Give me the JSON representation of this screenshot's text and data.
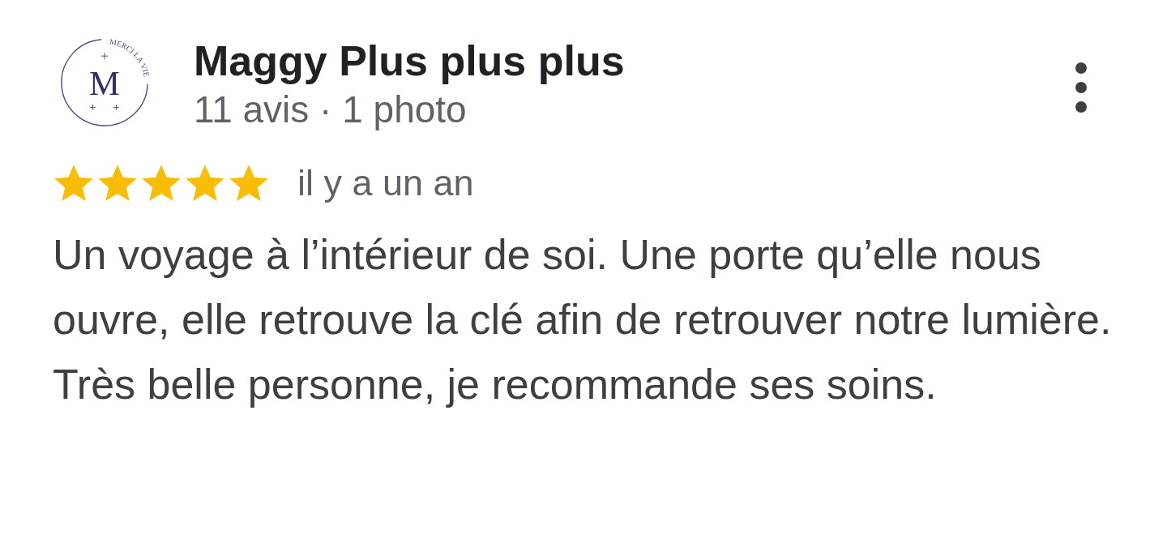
{
  "review": {
    "avatar": {
      "letter": "M",
      "arc_text": "MERCI LA VIE"
    },
    "author": "Maggy Plus plus plus",
    "meta": "11 avis · 1 photo",
    "stars": 5,
    "time": "il y a un an",
    "paragraphs": [
      "Un voyage à l’intérieur de soi. Une porte qu’elle nous ouvre, elle retrouve la clé afin de retrouver notre lumière.",
      "Très belle personne, je recommande ses soins."
    ]
  }
}
